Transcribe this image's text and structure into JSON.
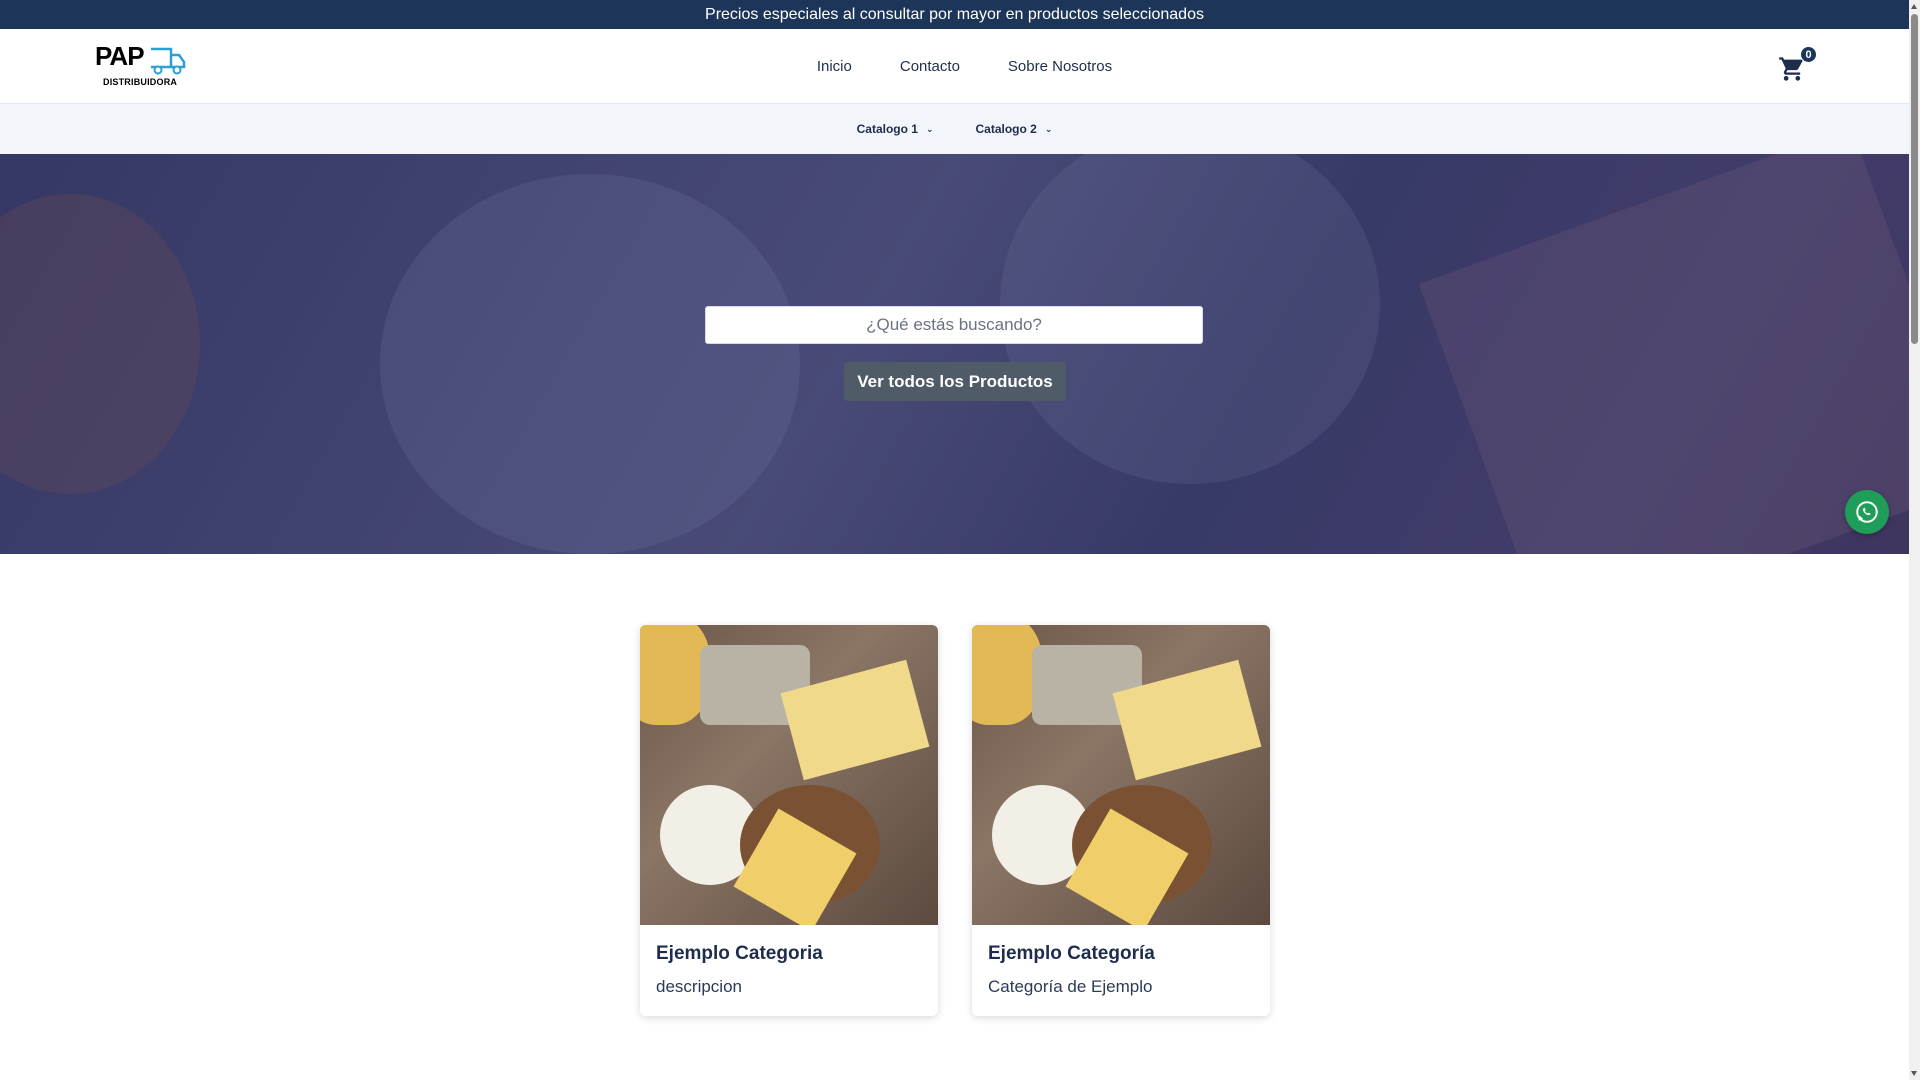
{
  "promo": {
    "text": "Precios especiales al consultar por mayor en productos seleccionados"
  },
  "header": {
    "logo": {
      "brand": "PAP",
      "subtitle": "DISTRIBUIDORA"
    },
    "nav": [
      {
        "label": "Inicio"
      },
      {
        "label": "Contacto"
      },
      {
        "label": "Sobre Nosotros"
      }
    ],
    "cart": {
      "count": "0",
      "icon": "cart-icon"
    }
  },
  "subnav": {
    "items": [
      {
        "label": "Catalogo 1",
        "icon": "chevron-down-icon"
      },
      {
        "label": "Catalogo 2",
        "icon": "chevron-down-icon"
      }
    ]
  },
  "hero": {
    "search": {
      "placeholder": "¿Qué estás buscando?",
      "value": ""
    },
    "button_label": "Ver todos los Productos"
  },
  "whatsapp": {
    "icon": "whatsapp-icon",
    "color": "#1e9e58"
  },
  "categories": [
    {
      "title": "Ejemplo Categoria",
      "description": "descripcion"
    },
    {
      "title": "Ejemplo Categoría",
      "description": "Categoría de Ejemplo"
    }
  ],
  "colors": {
    "promo_bg": "#1c3558",
    "text_primary": "#1f2d4d",
    "button_bg": "#4f5b66",
    "subnav_bg": "#f2f5fa"
  }
}
